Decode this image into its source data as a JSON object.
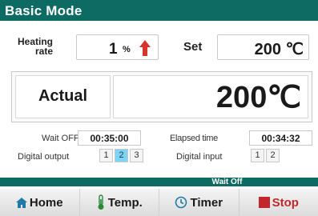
{
  "title": "Basic Mode",
  "heating_rate": {
    "label_line1": "Heating",
    "label_line2": "rate",
    "value": "1",
    "unit": "%"
  },
  "set": {
    "label": "Set",
    "value": "200 ℃"
  },
  "actual": {
    "label": "Actual",
    "value": "200℃"
  },
  "wait": {
    "label": "Wait OFF",
    "value": "00:35:00"
  },
  "elapsed": {
    "label": "Elapsed time",
    "value": "00:34:32"
  },
  "digital_output": {
    "label": "Digital output",
    "channels": [
      "1",
      "2",
      "3"
    ],
    "active": [
      false,
      true,
      false
    ]
  },
  "digital_input": {
    "label": "Digital input",
    "channels": [
      "1",
      "2"
    ],
    "active": [
      false,
      false
    ]
  },
  "status": "Wait Off",
  "nav": {
    "home": "Home",
    "temp": "Temp.",
    "timer": "Timer",
    "stop": "Stop"
  },
  "colors": {
    "header": "#0e6b63",
    "arrow": "#d9342b",
    "stop": "#c1272d",
    "io_active": "#7ed4f4"
  },
  "icons": {
    "home": "home-icon",
    "temp": "thermometer-icon",
    "timer": "clock-icon",
    "stop": "stop-square-icon",
    "rate": "arrow-up-icon"
  }
}
